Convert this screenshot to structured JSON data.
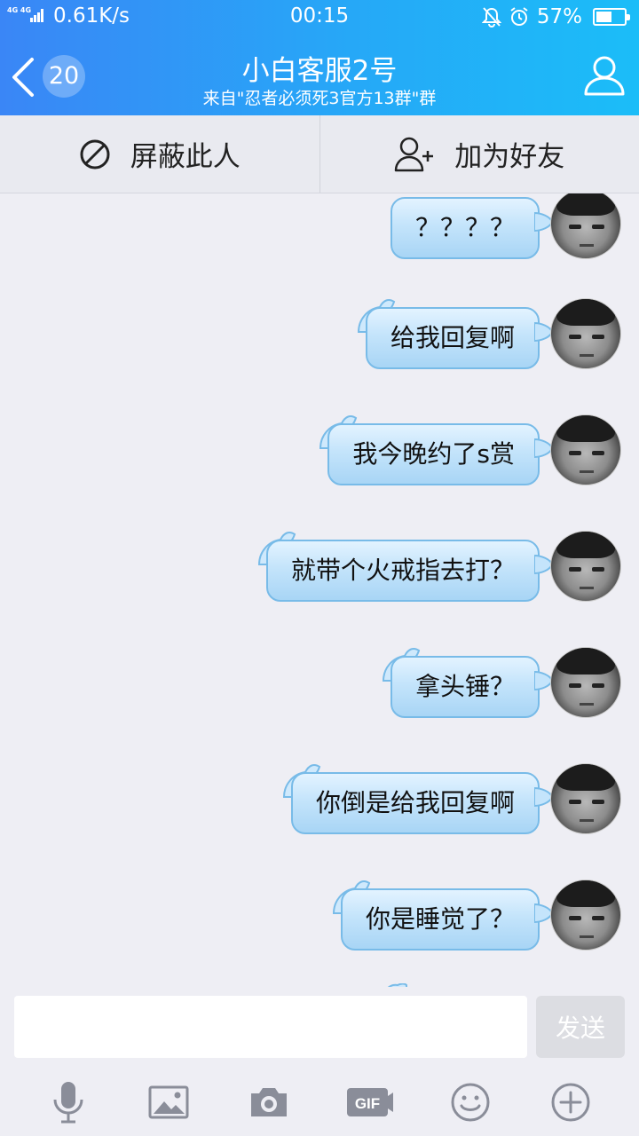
{
  "status_bar": {
    "network": "4G 4G",
    "speed": "0.61K/s",
    "time": "00:15",
    "battery_text": "57%",
    "battery_level": 0.57
  },
  "header": {
    "unread_count": "20",
    "title": "小白客服2号",
    "subtitle": "来自\"忍者必须死3官方13群\"群"
  },
  "actions": {
    "block_label": "屏蔽此人",
    "add_friend_label": "加为好友"
  },
  "messages": [
    {
      "text": "？？？？"
    },
    {
      "text": "给我回复啊"
    },
    {
      "text": "我今晚约了s赏"
    },
    {
      "text": "就带个火戒指去打？"
    },
    {
      "text": "拿头锤？"
    },
    {
      "text": "你倒是给我回复啊"
    },
    {
      "text": "你是睡觉了？"
    }
  ],
  "input": {
    "value": "",
    "send_label": "发送"
  },
  "toolbar": {
    "icons": [
      "microphone-icon",
      "image-icon",
      "camera-icon",
      "gif-icon",
      "emoji-icon",
      "plus-icon"
    ],
    "gif_label": "GIF"
  },
  "colors": {
    "header_start": "#3a86f6",
    "header_end": "#1bbdf8",
    "bubble": "#a8d5f5",
    "bubble_border": "#78bbe8",
    "icon_gray": "#8a8d99"
  }
}
